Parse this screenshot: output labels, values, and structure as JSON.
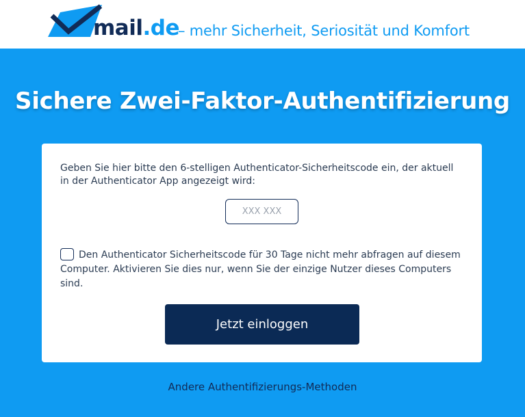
{
  "header": {
    "logo_name": "mail",
    "logo_tld": ".de",
    "slogan": "– mehr Sicherheit, Seriosität und Komfort"
  },
  "page": {
    "title": "Sichere Zwei-Faktor-Authentifizierung"
  },
  "form": {
    "instructions": "Geben Sie hier bitte den 6-stelligen Authenticator-Sicherheitscode ein, der aktuell in der Authenticator App angezeigt wird:",
    "code_placeholder": "XXX XXX",
    "code_value": "",
    "remember_label": "Den Authenticator Sicherheitscode für 30 Tage nicht mehr abfragen auf diesem Computer. Aktivieren Sie dies nur, wenn Sie der einzige Nutzer dieses Computers sind.",
    "remember_checked": false,
    "login_button": "Jetzt einloggen"
  },
  "footer": {
    "other_methods_link": "Andere Authentifizierungs-Methoden"
  },
  "colors": {
    "background": "#0f9bf2",
    "brand_dark": "#112b57",
    "button": "#0b2a55",
    "card": "#ffffff"
  },
  "icons": {
    "logo": "paper-plane-check-icon",
    "checkbox": "checkbox-unchecked-icon"
  }
}
